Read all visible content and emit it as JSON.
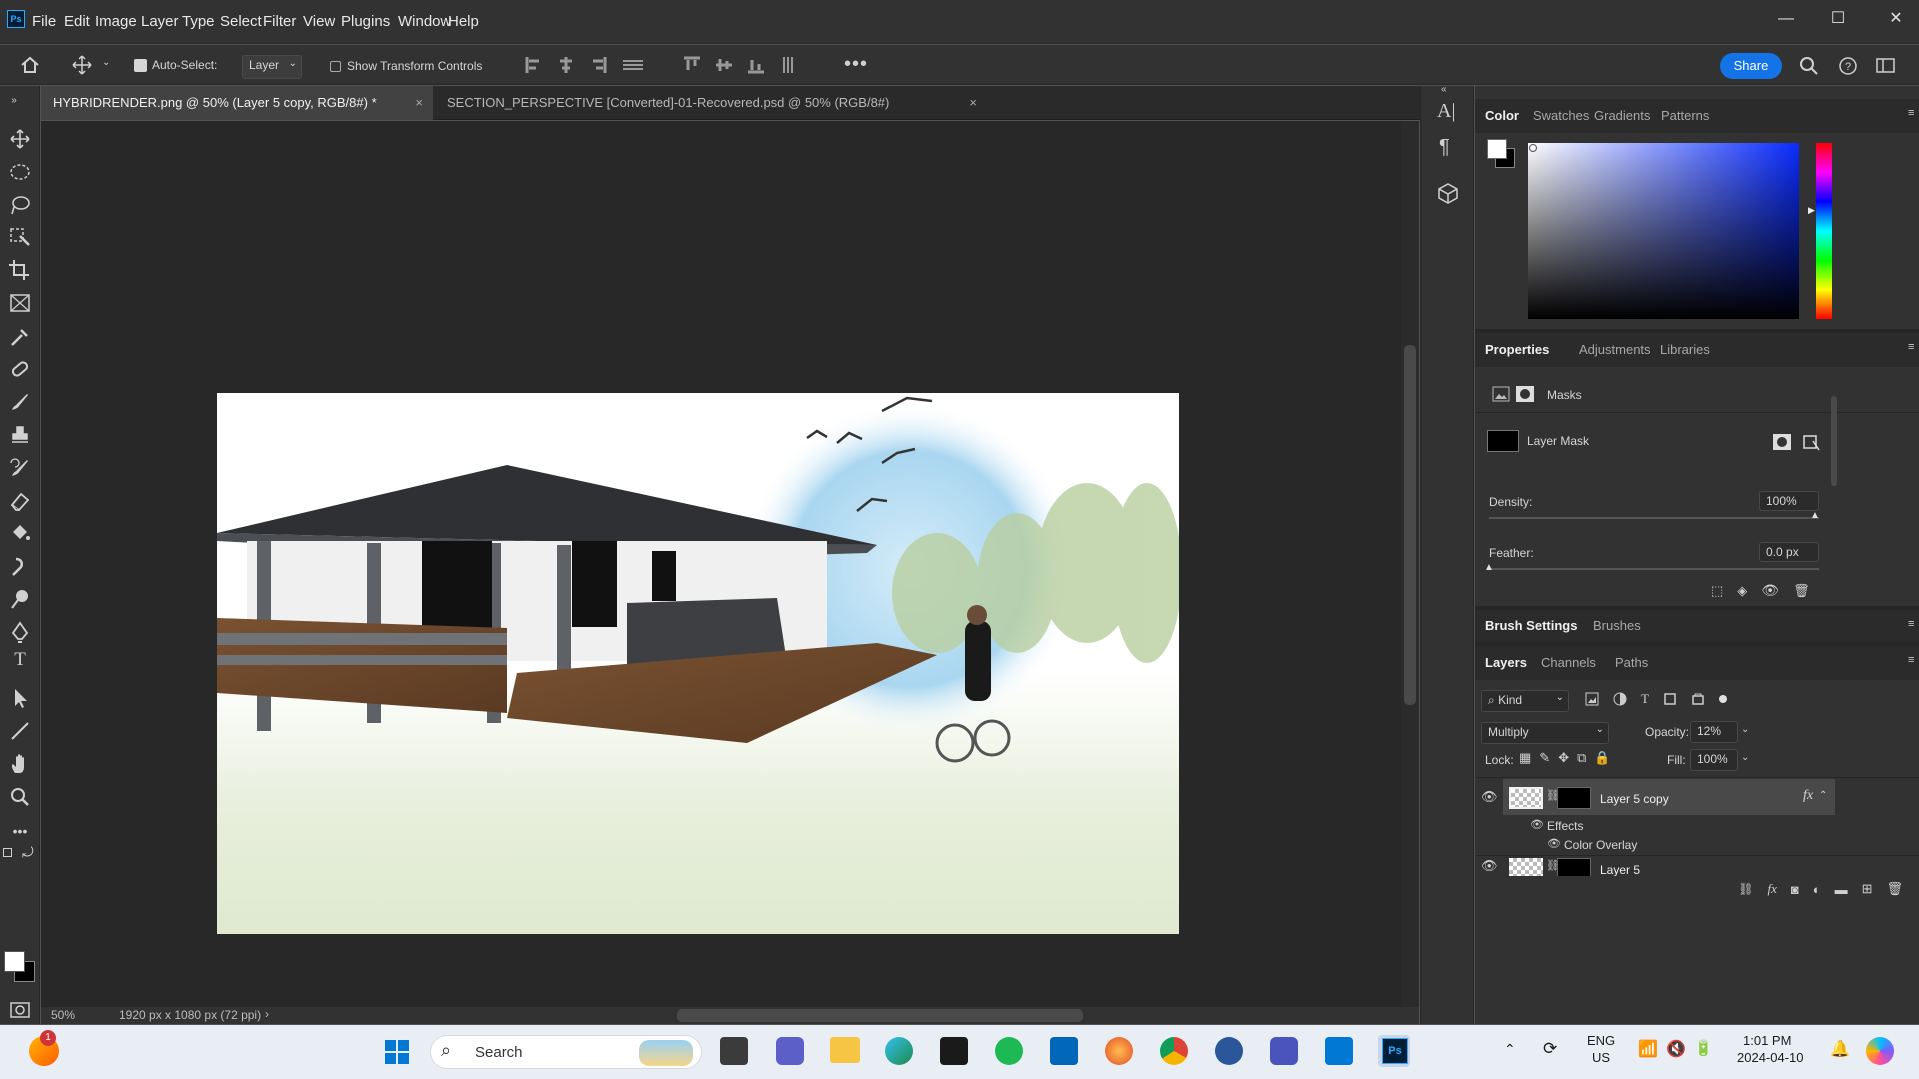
{
  "app": {
    "logo": "Ps"
  },
  "menu": [
    "File",
    "Edit",
    "Image",
    "Layer",
    "Type",
    "Select",
    "Filter",
    "View",
    "Plugins",
    "Window",
    "Help"
  ],
  "window_controls": {
    "minimize": "—",
    "maximize": "☐",
    "close": "✕"
  },
  "options_bar": {
    "auto_select_label": "Auto-Select:",
    "auto_select_checked": true,
    "auto_select_target": "Layer",
    "show_transform_label": "Show Transform Controls",
    "share_label": "Share"
  },
  "tabs": [
    {
      "label": "HYBRIDRENDER.png @ 50% (Layer 5 copy, RGB/8#) *",
      "active": true
    },
    {
      "label": "SECTION_PERSPECTIVE [Converted]-01-Recovered.psd @ 50% (RGB/8#)",
      "active": false
    }
  ],
  "status": {
    "zoom": "50%",
    "doc_info": "1920 px x 1080 px (72 ppi)"
  },
  "color_panel": {
    "tabs": [
      "Color",
      "Swatches",
      "Gradients",
      "Patterns"
    ],
    "active_tab": "Color",
    "foreground": "#ffffff",
    "background": "#000000",
    "hue_color": "#0a2cff"
  },
  "properties_panel": {
    "tabs": [
      "Properties",
      "Adjustments",
      "Libraries"
    ],
    "active_tab": "Properties",
    "section": "Masks",
    "mask_label": "Layer Mask",
    "density_label": "Density:",
    "density_value": "100%",
    "feather_label": "Feather:",
    "feather_value": "0.0 px"
  },
  "brush_panel": {
    "tabs": [
      "Brush Settings",
      "Brushes"
    ],
    "active_tab": "Brush Settings"
  },
  "layers_panel": {
    "tabs": [
      "Layers",
      "Channels",
      "Paths"
    ],
    "active_tab": "Layers",
    "filter_kind": "Kind",
    "blend_mode": "Multiply",
    "opacity_label": "Opacity:",
    "opacity_value": "12%",
    "lock_label": "Lock:",
    "fill_label": "Fill:",
    "fill_value": "100%",
    "layers": [
      {
        "name": "Layer 5 copy",
        "selected": true,
        "fx": "fx",
        "effects_label": "Effects",
        "effect": "Color Overlay"
      },
      {
        "name": "Layer 5",
        "selected": false
      }
    ]
  },
  "taskbar": {
    "notification_badge": "1",
    "search_placeholder": "Search",
    "language": "ENG",
    "region": "US",
    "time": "1:01 PM",
    "date": "2024-04-10"
  }
}
